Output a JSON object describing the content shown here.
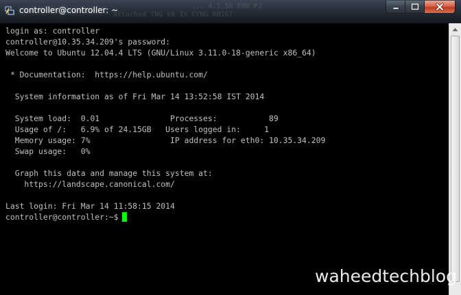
{
  "window": {
    "title": "controller@controller: ~",
    "app_icon": "putty-icon",
    "controls": {
      "minimize": "minimize-icon",
      "maximize": "maximize-icon",
      "close": "close-icon"
    }
  },
  "background_ghost": {
    "line1": "                   ... 4.1.56 F00 PJ",
    "line2": "attached TNG kB Is CYNG RB1G?"
  },
  "terminal": {
    "lines": [
      "login as: controller",
      "controller@10.35.34.209's password:",
      "Welcome to Ubuntu 12.04.4 LTS (GNU/Linux 3.11.0-18-generic x86_64)",
      "",
      " * Documentation:  https://help.ubuntu.com/",
      "",
      "  System information as of Fri Mar 14 13:52:58 IST 2014",
      "",
      "  System load:  0.01               Processes:           89",
      "  Usage of /:   6.9% of 24.15GB   Users logged in:     1",
      "  Memory usage: 7%                 IP address for eth0: 10.35.34.209",
      "  Swap usage:   0%",
      "",
      "  Graph this data and manage this system at:",
      "    https://landscape.canonical.com/",
      "",
      "Last login: Fri Mar 14 11:58:15 2014"
    ],
    "prompt": "controller@controller:~$",
    "cursor_color": "#00ff00",
    "text_color": "#c0c0c0",
    "background_color": "#000000"
  },
  "watermark": "waheedtechblog"
}
